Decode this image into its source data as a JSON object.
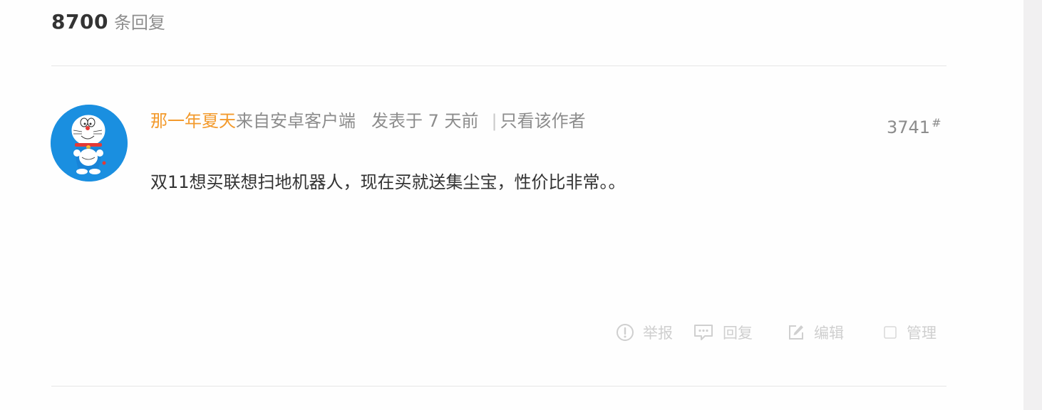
{
  "header": {
    "reply_count": "8700",
    "reply_unit": "条回复"
  },
  "post": {
    "author": "那一年夏天",
    "source": "来自安卓客户端",
    "posted": "发表于 7 天前",
    "separator": "|",
    "only_author_label": "只看该作者",
    "floor_number": "3741",
    "floor_hash": "#",
    "content": "双11想买联想扫地机器人，现在买就送集尘宝，性价比非常。。"
  },
  "actions": {
    "report_label": "举报",
    "reply_label": "回复",
    "edit_label": "编辑",
    "manage_label": "管理"
  },
  "colors": {
    "author": "#f39a2c",
    "avatar_bg": "#1a8fe0",
    "muted_text": "#8c8c8c",
    "action_text": "#cfcfcf"
  },
  "icons": {
    "report": "alert-circle-icon",
    "reply": "chat-bubble-icon",
    "edit": "edit-pencil-icon",
    "manage": "checkbox-icon"
  }
}
